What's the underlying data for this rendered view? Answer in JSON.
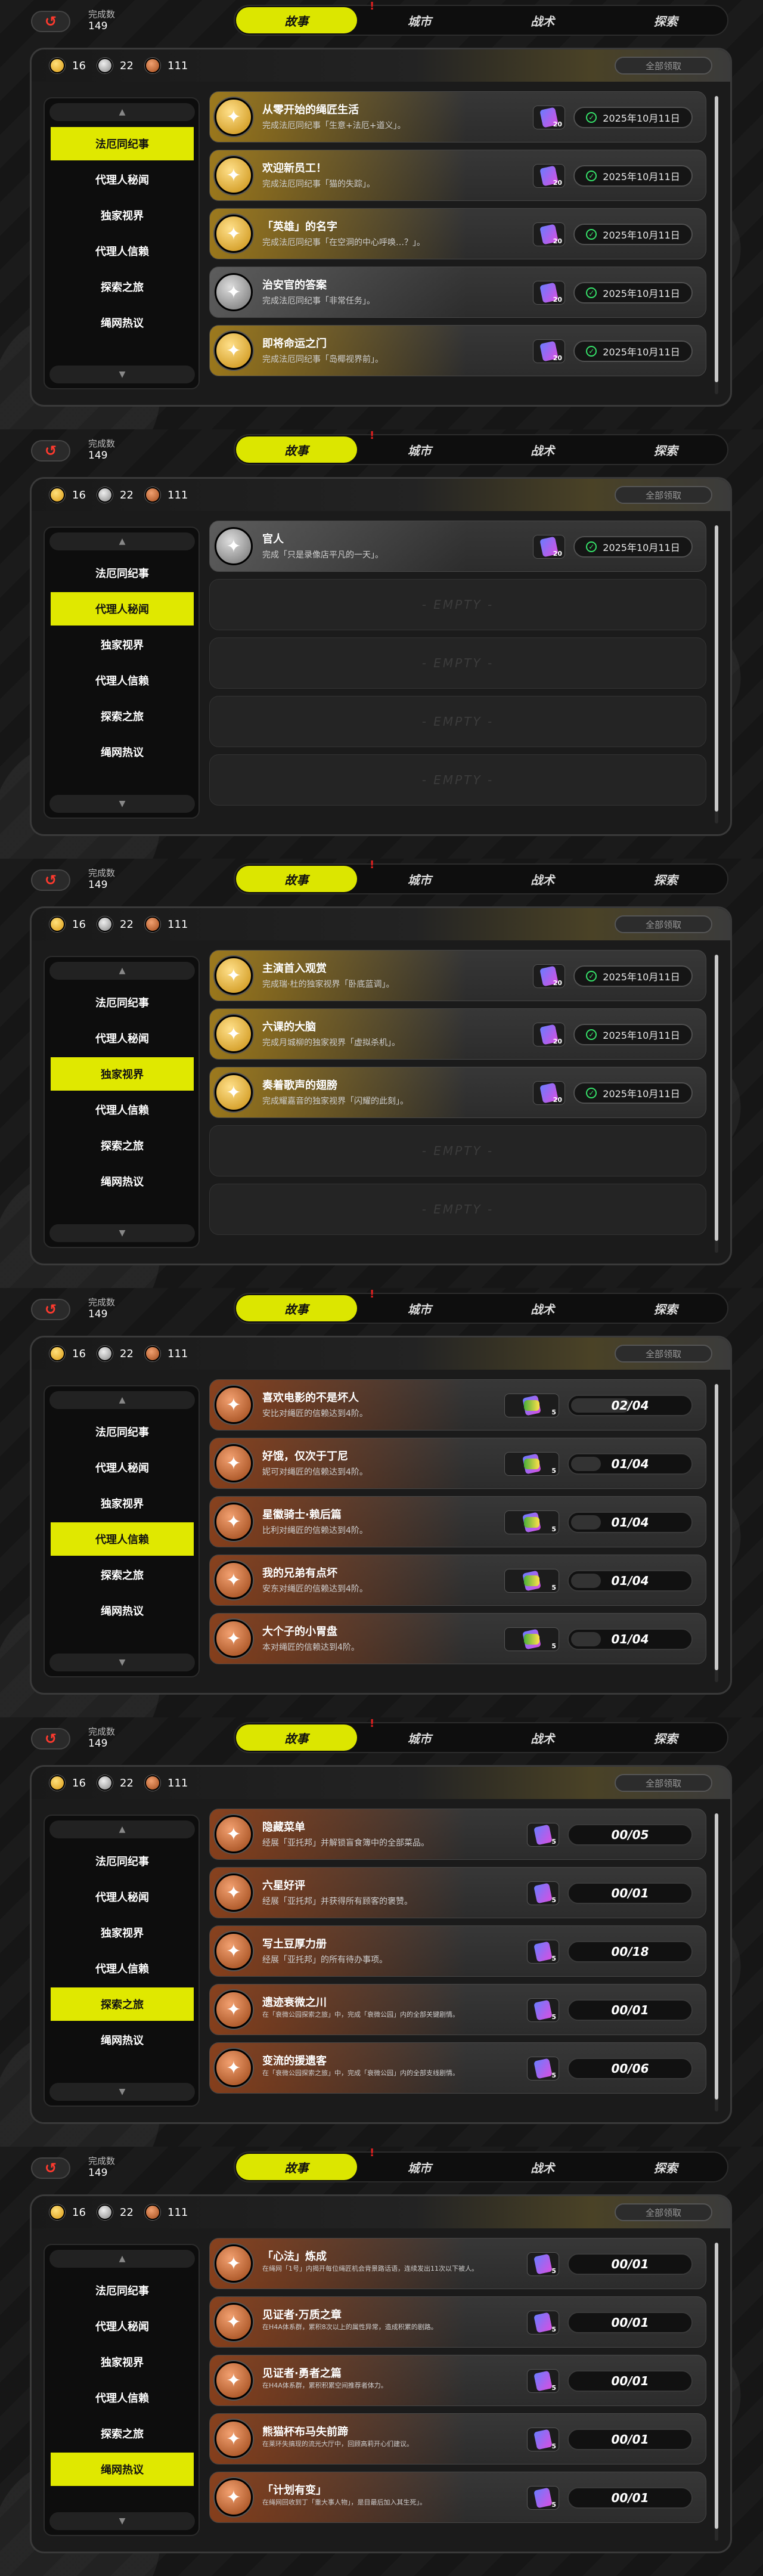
{
  "currency": {
    "gold": "16",
    "silver": "22",
    "bronze": "111"
  },
  "header": {
    "completed_label": "完成数",
    "completed_value": "149",
    "claim_all": "全部领取"
  },
  "tabs": [
    "故事",
    "城市",
    "战术",
    "探索"
  ],
  "categories": [
    "法厄同纪事",
    "代理人秘闻",
    "独家视界",
    "代理人信赖",
    "探索之旅",
    "绳网热议"
  ],
  "empty_label": "- EMPTY -",
  "panels": [
    {
      "active_category": 0,
      "rows": [
        {
          "kind": "gold",
          "title": "从零开始的绳匠生活",
          "desc": "完成法厄同纪事「生意+法厄+道义」。",
          "reward": "20",
          "status": "done",
          "date": "2025年10月11日"
        },
        {
          "kind": "gold",
          "title": "欢迎新员工！",
          "desc": "完成法厄同纪事「猫的失踪」。",
          "reward": "20",
          "status": "done",
          "date": "2025年10月11日"
        },
        {
          "kind": "gold",
          "title": "「英雄」的名字",
          "desc": "完成法厄同纪事「在空洞的中心呼唤…？」。",
          "reward": "20",
          "status": "done",
          "date": "2025年10月11日"
        },
        {
          "kind": "grey",
          "title": "治安官的答案",
          "desc": "完成法厄同纪事「非常任务」。",
          "reward": "20",
          "status": "done",
          "date": "2025年10月11日"
        },
        {
          "kind": "gold",
          "title": "即将命运之门",
          "desc": "完成法厄同纪事「岛椰视界前」。",
          "reward": "20",
          "status": "done",
          "date": "2025年10月11日"
        }
      ]
    },
    {
      "active_category": 1,
      "rows": [
        {
          "kind": "grey",
          "title": "官人",
          "desc": "完成「只是录像店平凡的一天」。",
          "reward": "20",
          "status": "done",
          "date": "2025年10月11日"
        }
      ],
      "empty_rows": 4
    },
    {
      "active_category": 2,
      "rows": [
        {
          "kind": "gold",
          "title": "主演首入观赏",
          "desc": "完成瑞·杜的独家视界「卧底蓝调」。",
          "reward": "20",
          "status": "done",
          "date": "2025年10月11日"
        },
        {
          "kind": "gold",
          "title": "六课的大脑",
          "desc": "完成月城柳的独家视界「虚拟杀机」。",
          "reward": "20",
          "status": "done",
          "date": "2025年10月11日"
        },
        {
          "kind": "gold",
          "title": "奏着歌声的翅膀",
          "desc": "完成耀嘉音的独家视界「闪耀的此刻」。",
          "reward": "20",
          "status": "done",
          "date": "2025年10月11日"
        }
      ],
      "empty_rows": 2
    },
    {
      "active_category": 3,
      "rows": [
        {
          "kind": "bronze",
          "title": "喜欢电影的不是坏人",
          "desc": "安比对绳匠的信赖达到4阶。",
          "reward": "5",
          "reward2": "5",
          "status": "progress",
          "progress": "02/04",
          "ratio": 0.5
        },
        {
          "kind": "bronze",
          "title": "好饿，仅次于丁尼",
          "desc": "妮可对绳匠的信赖达到4阶。",
          "reward": "5",
          "reward2": "5",
          "status": "progress",
          "progress": "01/04",
          "ratio": 0.25
        },
        {
          "kind": "bronze",
          "title": "星徽骑士·赖后篇",
          "desc": "比利对绳匠的信赖达到4阶。",
          "reward": "5",
          "reward2": "5",
          "status": "progress",
          "progress": "01/04",
          "ratio": 0.25
        },
        {
          "kind": "bronze",
          "title": "我的兄弟有点坏",
          "desc": "安东对绳匠的信赖达到4阶。",
          "reward": "5",
          "reward2": "5",
          "status": "progress",
          "progress": "01/04",
          "ratio": 0.25
        },
        {
          "kind": "bronze",
          "title": "大个子的小胃盘",
          "desc": "本对绳匠的信赖达到4阶。",
          "reward": "5",
          "reward2": "5",
          "status": "progress",
          "progress": "01/04",
          "ratio": 0.25
        }
      ]
    },
    {
      "active_category": 4,
      "rows": [
        {
          "kind": "bronze",
          "title": "隐藏菜单",
          "desc": "经展「亚托邦」并解锁盲食簿中的全部菜品。",
          "reward": "5",
          "status": "progress",
          "progress": "00/05",
          "ratio": 0
        },
        {
          "kind": "bronze",
          "title": "六星好评",
          "desc": "经展「亚托邦」并获得所有顾客的褒赞。",
          "reward": "5",
          "status": "progress",
          "progress": "00/01",
          "ratio": 0
        },
        {
          "kind": "bronze",
          "title": "写土豆厚力册",
          "desc": "经展「亚托邦」的所有待办事项。",
          "reward": "5",
          "status": "progress",
          "progress": "00/18",
          "ratio": 0
        },
        {
          "kind": "bronze",
          "title": "遗迹衰微之川",
          "desc": "在「衰微公园探索之旅」中，完成「衰微公园」内的全部关键剧情。",
          "reward": "5",
          "status": "progress",
          "progress": "00/01",
          "ratio": 0,
          "small": true
        },
        {
          "kind": "bronze",
          "title": "变流的援遗客",
          "desc": "在「衰微公园探索之旅」中，完成「衰微公园」内的全部支线剧情。",
          "reward": "5",
          "status": "progress",
          "progress": "00/06",
          "ratio": 0,
          "small": true
        }
      ]
    },
    {
      "active_category": 5,
      "rows": [
        {
          "kind": "bronze",
          "title": "「心法」炼成",
          "desc": "在绳网「1号」内揭开每位绳匠机会背景路话语，连续发出11次以下被人。",
          "reward": "5",
          "status": "progress",
          "progress": "00/01",
          "ratio": 0,
          "small": true
        },
        {
          "kind": "bronze",
          "title": "见证者·万质之章",
          "desc": "在H4A体系群，累积8次以上的属性异常，造成积累的剧路。",
          "reward": "5",
          "status": "progress",
          "progress": "00/01",
          "ratio": 0,
          "small": true
        },
        {
          "kind": "bronze",
          "title": "见证者·勇者之篇",
          "desc": "在H4A体系群，累积积累空间推荐者体力。",
          "reward": "5",
          "status": "progress",
          "progress": "00/01",
          "ratio": 0,
          "small": true
        },
        {
          "kind": "bronze",
          "title": "熊猫杯布马失前蹄",
          "desc": "在莱环失搞现的流光大厅中，回顾高莉开心们建议。",
          "reward": "5",
          "status": "progress",
          "progress": "00/01",
          "ratio": 0,
          "small": true
        },
        {
          "kind": "bronze",
          "title": "「计划有变」",
          "desc": "在绳网回收到丁「重大事人物」，是目最后加入其生死」。",
          "reward": "5",
          "status": "progress",
          "progress": "00/01",
          "ratio": 0,
          "small": true
        }
      ]
    }
  ]
}
